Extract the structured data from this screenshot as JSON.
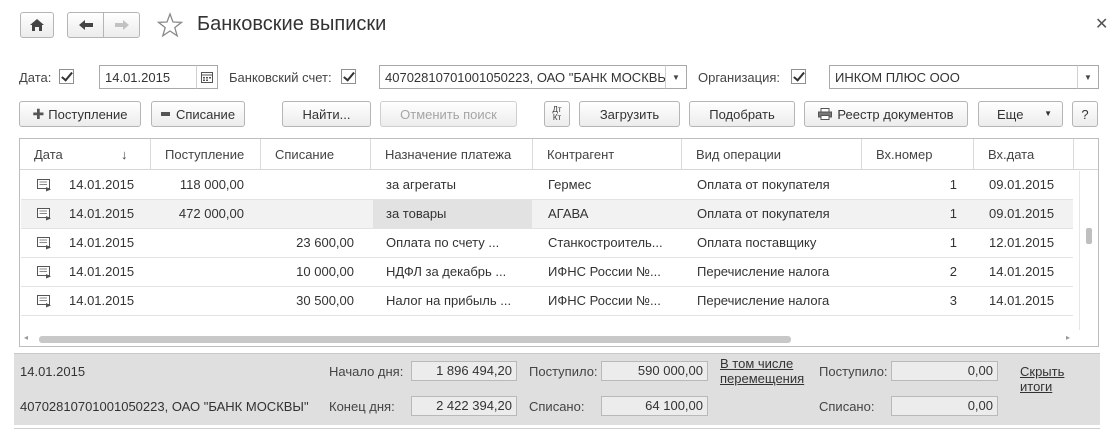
{
  "window": {
    "title": "Банковские выписки"
  },
  "filters": {
    "date_label": "Дата:",
    "date_value": "14.01.2015",
    "account_label": "Банковский счет:",
    "account_value": "40702810701001050223, ОАО \"БАНК МОСКВЫ\"",
    "org_label": "Организация:",
    "org_value": "ИНКОМ ПЛЮС ООО"
  },
  "toolbar": {
    "income": "Поступление",
    "expense": "Списание",
    "find": "Найти...",
    "cancel_search": "Отменить поиск",
    "load": "Загрузить",
    "select": "Подобрать",
    "registry": "Реестр документов",
    "more": "Еще",
    "help": "?"
  },
  "table": {
    "columns": [
      "Дата",
      "Поступление",
      "Списание",
      "Назначение платежа",
      "Контрагент",
      "Вид операции",
      "Вх.номер",
      "Вх.дата"
    ],
    "rows": [
      {
        "date": "14.01.2015",
        "income": "118 000,00",
        "expense": "",
        "purpose": "за агрегаты",
        "counterparty": "Гермес",
        "operation": "Оплата от покупателя",
        "in_num": "1",
        "in_date": "09.01.2015"
      },
      {
        "date": "14.01.2015",
        "income": "472 000,00",
        "expense": "",
        "purpose": "за товары",
        "counterparty": "АГАВА",
        "operation": "Оплата от покупателя",
        "in_num": "1",
        "in_date": "09.01.2015"
      },
      {
        "date": "14.01.2015",
        "income": "",
        "expense": "23 600,00",
        "purpose": "Оплата по  счету ...",
        "counterparty": "Станкостроитель...",
        "operation": "Оплата поставщику",
        "in_num": "1",
        "in_date": "12.01.2015"
      },
      {
        "date": "14.01.2015",
        "income": "",
        "expense": "10 000,00",
        "purpose": "НДФЛ за декабрь ...",
        "counterparty": "ИФНС России №...",
        "operation": "Перечисление налога",
        "in_num": "2",
        "in_date": "14.01.2015"
      },
      {
        "date": "14.01.2015",
        "income": "",
        "expense": "30 500,00",
        "purpose": "Налог на прибыль ...",
        "counterparty": "ИФНС России №...",
        "operation": "Перечисление налога",
        "in_num": "3",
        "in_date": "14.01.2015"
      }
    ]
  },
  "summary": {
    "date": "14.01.2015",
    "account": "40702810701001050223, ОАО \"БАНК МОСКВЫ\"",
    "start_label": "Начало дня:",
    "start_value": "1 896 494,20",
    "end_label": "Конец дня:",
    "end_value": "2 422 394,20",
    "received_label": "Поступило:",
    "received_value": "590 000,00",
    "spent_label": "Списано:",
    "spent_value": "64 100,00",
    "transfers_link_line1": "В том числе",
    "transfers_link_line2": "перемещения",
    "received2_label": "Поступило:",
    "received2_value": "0,00",
    "spent2_label": "Списано:",
    "spent2_value": "0,00",
    "hide_totals": "Скрыть итоги"
  }
}
